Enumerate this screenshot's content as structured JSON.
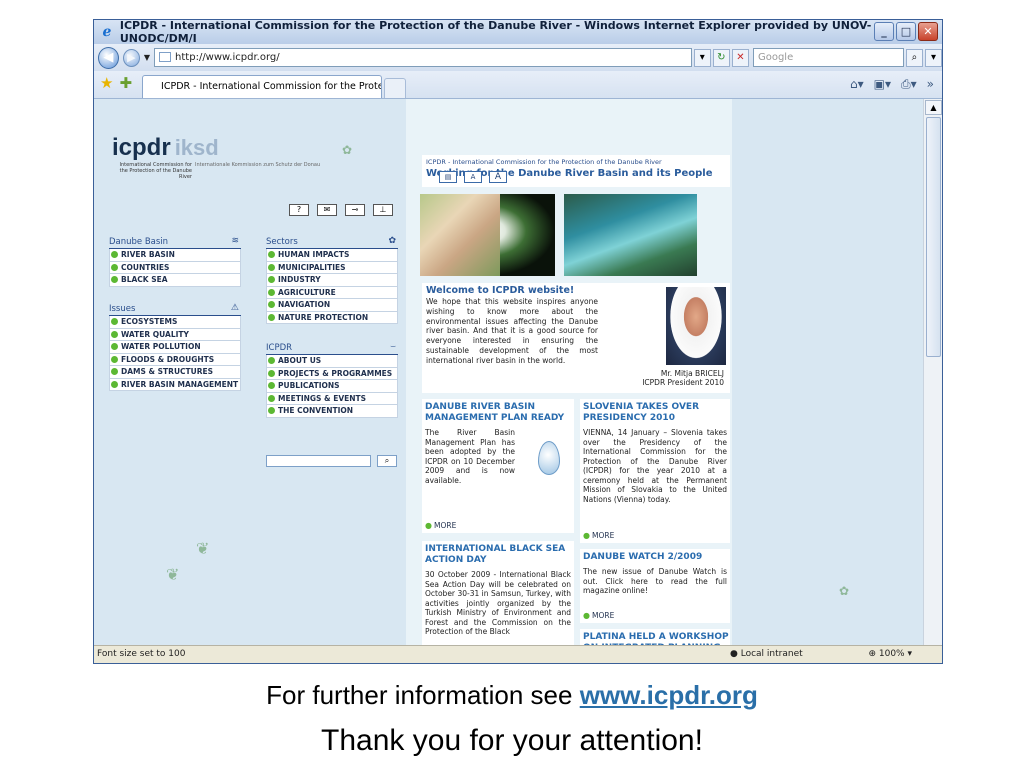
{
  "window": {
    "title": "ICPDR - International Commission for the Protection of the Danube River - Windows Internet Explorer provided by UNOV-UNODC/DM/I"
  },
  "address": {
    "url": "http://www.icpdr.org/",
    "search_placeholder": "Google"
  },
  "tab": {
    "label": "ICPDR - International Commission for the Protection o..."
  },
  "logo": {
    "name": "icpdr",
    "name2": "iksd",
    "sub_en": "International Commission for the Protection of the Danube River",
    "sub_de": "Internationale Kommission zum Schutz der Donau"
  },
  "utility_icons": [
    "?",
    "✉",
    "⊸",
    "⊥"
  ],
  "menus": {
    "danube_basin": {
      "title": "Danube Basin",
      "items": [
        "RIVER BASIN",
        "COUNTRIES",
        "BLACK SEA"
      ]
    },
    "issues": {
      "title": "Issues",
      "items": [
        "ECOSYSTEMS",
        "WATER QUALITY",
        "WATER POLLUTION",
        "FLOODS & DROUGHTS",
        "DAMS & STRUCTURES",
        "RIVER BASIN MANAGEMENT"
      ]
    },
    "sectors": {
      "title": "Sectors",
      "items": [
        "HUMAN IMPACTS",
        "MUNICIPALITIES",
        "INDUSTRY",
        "AGRICULTURE",
        "NAVIGATION",
        "NATURE PROTECTION"
      ]
    },
    "icpdr": {
      "title": "ICPDR",
      "items": [
        "ABOUT US",
        "PROJECTS & PROGRAMMES",
        "PUBLICATIONS",
        "MEETINGS & EVENTS",
        "THE CONVENTION"
      ]
    }
  },
  "header": {
    "small": "ICPDR - International Commission for the Protection of the Danube River",
    "title": "Working for the Danube River Basin and its People"
  },
  "font_buttons": [
    "A",
    "A"
  ],
  "welcome": {
    "title": "Welcome to ICPDR website!",
    "text": "We hope that this website inspires anyone wishing to know more about the environmental issues affecting the Danube river basin. And that it is a good source for everyone interested in ensuring the sustainable development of the most international river basin in the world.",
    "caption_name": "Mr. Mitja BRICELJ",
    "caption_role": "ICPDR President 2010"
  },
  "news": {
    "n1": {
      "title": "DANUBE RIVER BASIN MANAGEMENT PLAN READY",
      "text": "The River Basin Management Plan has been adopted by the ICPDR on 10 December 2009 and is now available.",
      "more": "MORE"
    },
    "n2": {
      "title": "SLOVENIA TAKES OVER PRESIDENCY 2010",
      "text": "VIENNA, 14 January – Slovenia takes over the Presidency of the International Commission for the Protection of the Danube River (ICPDR) for the year 2010 at a ceremony held at the Permanent Mission of Slovakia to the United Nations (Vienna) today.",
      "more": "MORE"
    },
    "n3": {
      "title": "INTERNATIONAL BLACK SEA ACTION DAY",
      "text": "30 October 2009 - International Black Sea Action Day will be celebrated on October 30-31 in Samsun, Turkey, with activities jointly organized by the Turkish Ministry of Environment and Forest and the Commission on the Protection of the Black"
    },
    "n4": {
      "title": "DANUBE WATCH 2/2009",
      "text": "The new issue of Danube Watch is out. Click here to read the full magazine online!",
      "more": "MORE"
    },
    "n5": {
      "title": "PLATINA HELD A WORKSHOP ON INTEGRATED PLANNING"
    }
  },
  "status": {
    "text": "Font size set to 100",
    "zone": "Local intranet",
    "zoom": "100%"
  },
  "footer": {
    "line1_prefix": "For further information see ",
    "line1_link": "www.icpdr.org",
    "line2": "Thank you for your attention!"
  }
}
